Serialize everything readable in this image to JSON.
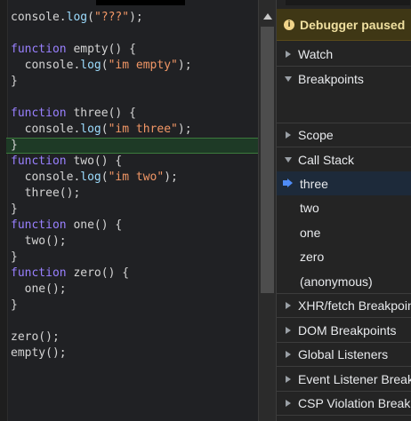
{
  "editor": {
    "lines": [
      [
        {
          "t": "console",
          "c": "fn"
        },
        {
          "t": ".",
          "c": "punc"
        },
        {
          "t": "log",
          "c": "prop"
        },
        {
          "t": "(",
          "c": "punc"
        },
        {
          "t": "\"???\"",
          "c": "str"
        },
        {
          "t": ");",
          "c": "punc"
        }
      ],
      [],
      [
        {
          "t": "function",
          "c": "kw"
        },
        {
          "t": " empty() {",
          "c": "fn"
        }
      ],
      [
        {
          "t": "  console",
          "c": "fn"
        },
        {
          "t": ".",
          "c": "punc"
        },
        {
          "t": "log",
          "c": "prop"
        },
        {
          "t": "(",
          "c": "punc"
        },
        {
          "t": "\"im empty\"",
          "c": "str"
        },
        {
          "t": ");",
          "c": "punc"
        }
      ],
      [
        {
          "t": "}",
          "c": "punc"
        }
      ],
      [],
      [
        {
          "t": "function",
          "c": "kw"
        },
        {
          "t": " three() {",
          "c": "fn"
        }
      ],
      [
        {
          "t": "  console",
          "c": "fn"
        },
        {
          "t": ".",
          "c": "punc"
        },
        {
          "t": "log",
          "c": "prop"
        },
        {
          "t": "(",
          "c": "punc"
        },
        {
          "t": "\"im three\"",
          "c": "str"
        },
        {
          "t": ");",
          "c": "punc"
        }
      ],
      [
        {
          "t": "}",
          "c": "punc"
        }
      ],
      [
        {
          "t": "function",
          "c": "kw"
        },
        {
          "t": " two() {",
          "c": "fn"
        }
      ],
      [
        {
          "t": "  console",
          "c": "fn"
        },
        {
          "t": ".",
          "c": "punc"
        },
        {
          "t": "log",
          "c": "prop"
        },
        {
          "t": "(",
          "c": "punc"
        },
        {
          "t": "\"im two\"",
          "c": "str"
        },
        {
          "t": ");",
          "c": "punc"
        }
      ],
      [
        {
          "t": "  three();",
          "c": "fn"
        }
      ],
      [
        {
          "t": "}",
          "c": "punc"
        }
      ],
      [
        {
          "t": "function",
          "c": "kw"
        },
        {
          "t": " one() {",
          "c": "fn"
        }
      ],
      [
        {
          "t": "  two();",
          "c": "fn"
        }
      ],
      [
        {
          "t": "}",
          "c": "punc"
        }
      ],
      [
        {
          "t": "function",
          "c": "kw"
        },
        {
          "t": " zero() {",
          "c": "fn"
        }
      ],
      [
        {
          "t": "  one();",
          "c": "fn"
        }
      ],
      [
        {
          "t": "}",
          "c": "punc"
        }
      ],
      [],
      [
        {
          "t": "zero();",
          "c": "fn"
        }
      ],
      [
        {
          "t": "empty();",
          "c": "fn"
        }
      ]
    ],
    "highlighted_line_index": 8
  },
  "panel": {
    "paused_label": "Debugger paused",
    "watch_label": "Watch",
    "breakpoints_label": "Breakpoints",
    "scope_label": "Scope",
    "call_stack_label": "Call Stack",
    "frames": [
      "three",
      "two",
      "one",
      "zero",
      "(anonymous)"
    ],
    "current_frame_index": 0,
    "bottom_sections": [
      "XHR/fetch Breakpoints",
      "DOM Breakpoints",
      "Global Listeners",
      "Event Listener Breakpoints",
      "CSP Violation Breakpoints"
    ]
  },
  "colors": {
    "keyword": "#9980ff",
    "string": "#f29766",
    "property": "#9cdcfe",
    "paused_banner_bg": "#3f3715",
    "current_frame_arrow": "#4f8cf7"
  },
  "icons": {
    "info": "info-icon",
    "collapsed": "triangle-right-icon",
    "expanded": "triangle-down-icon",
    "current_frame": "current-frame-arrow-icon",
    "scroll_up": "scroll-up-arrow-icon"
  }
}
